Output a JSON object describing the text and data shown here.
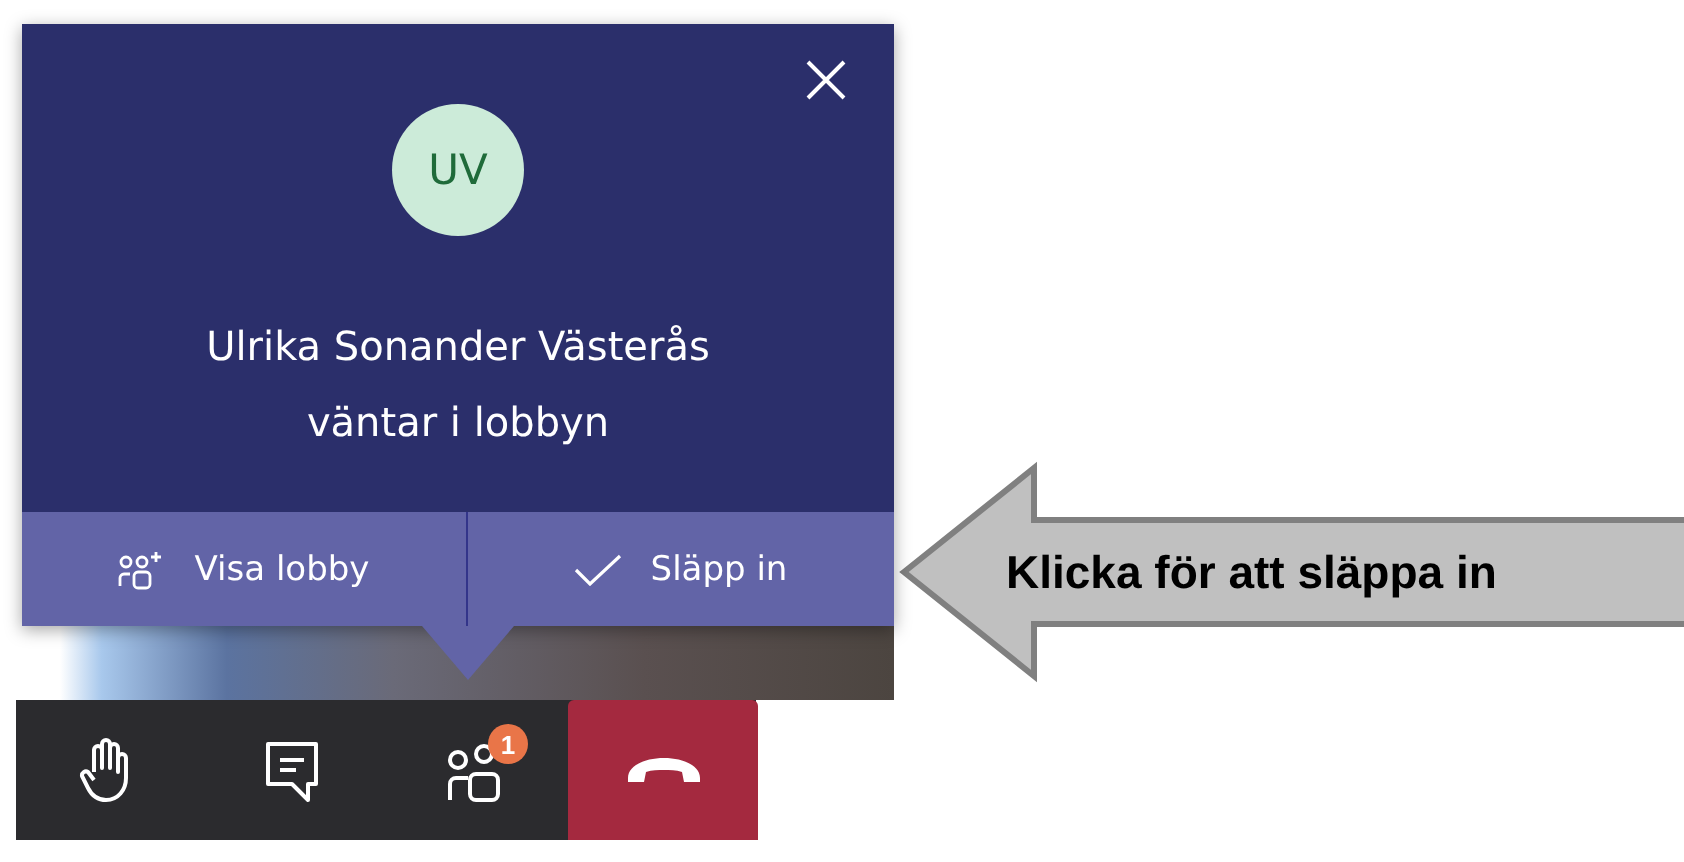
{
  "lobby_notification": {
    "avatar_initials": "UV",
    "message": "Ulrika Sonander Västerås väntar i lobbyn",
    "actions": [
      {
        "kind": "view-lobby",
        "label": "Visa lobby"
      },
      {
        "kind": "admit",
        "label": "Släpp in"
      }
    ]
  },
  "call_toolbar": [
    {
      "kind": "raise-hand"
    },
    {
      "kind": "chat"
    },
    {
      "kind": "participants",
      "badge": "1"
    },
    {
      "kind": "hang-up"
    }
  ],
  "callout": {
    "text": "Klicka för att släppa in"
  }
}
